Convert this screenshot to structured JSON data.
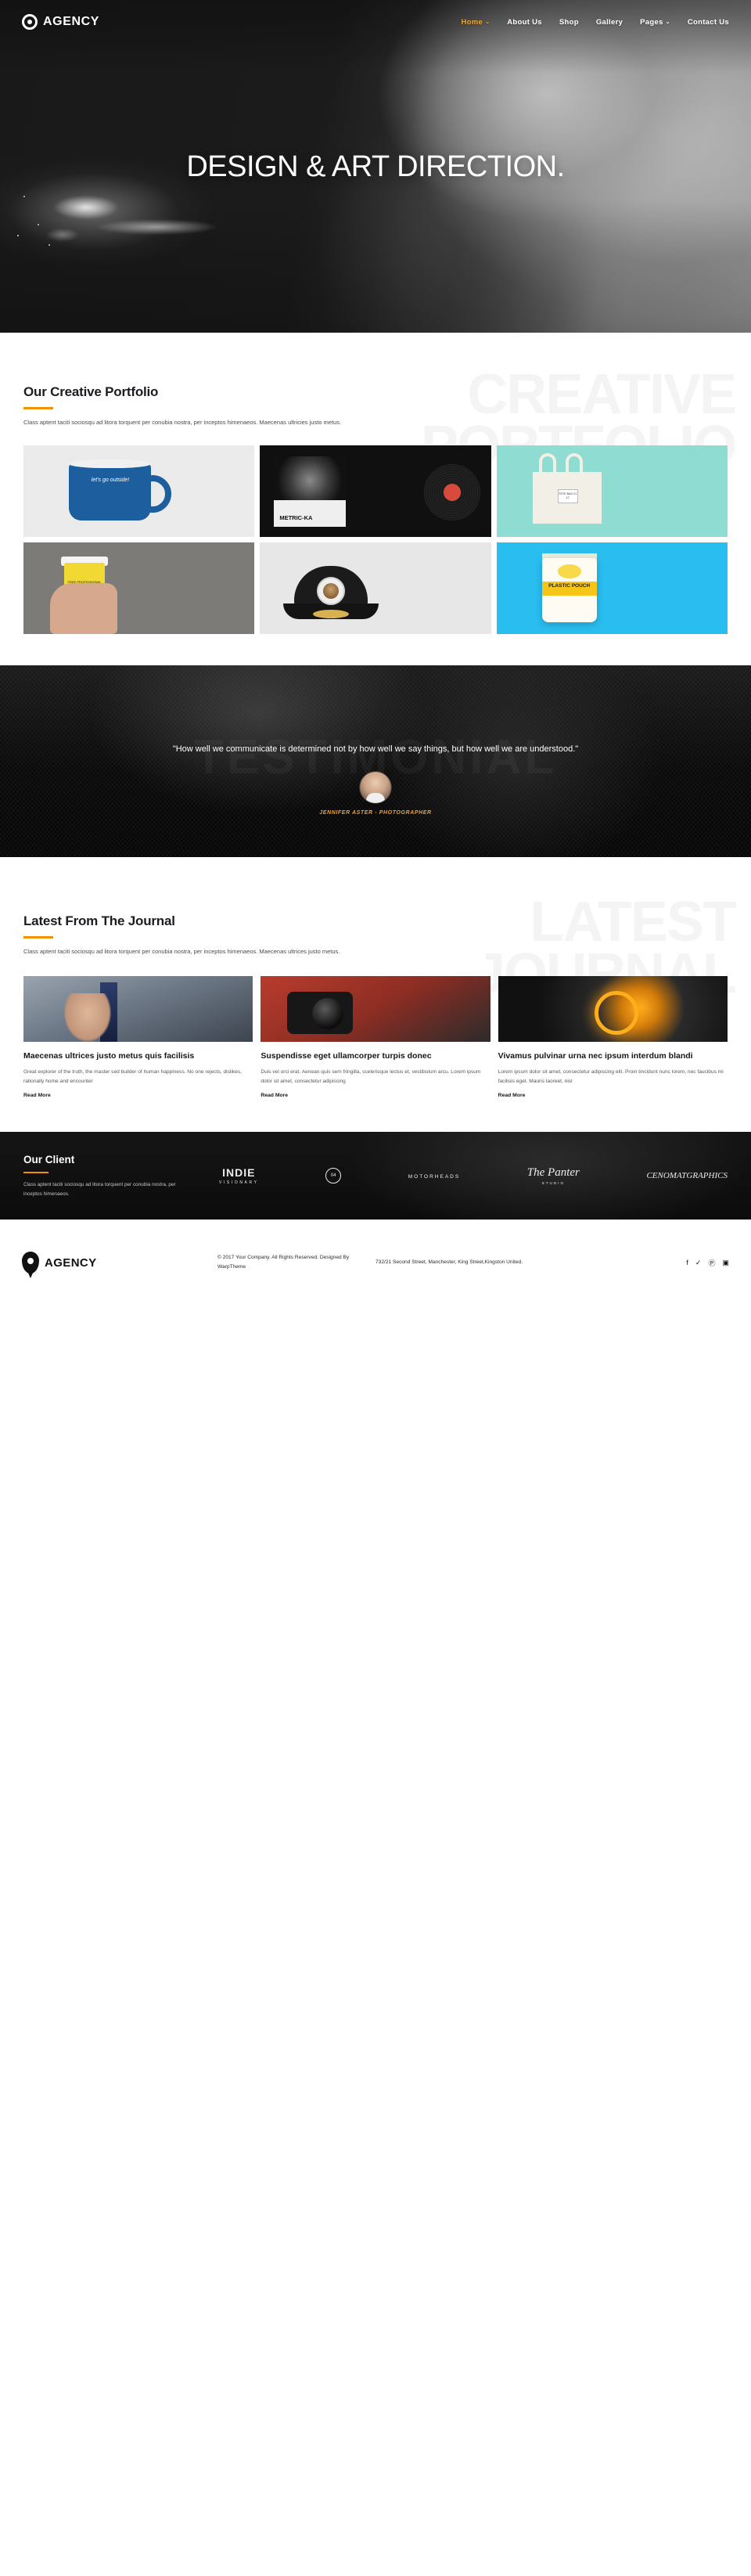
{
  "brand": {
    "name": "AGENCY",
    "icon": "location-pin-icon"
  },
  "nav": {
    "items": [
      {
        "label": "Home",
        "active": true,
        "caret": "⌄"
      },
      {
        "label": "About Us",
        "active": false,
        "caret": ""
      },
      {
        "label": "Shop",
        "active": false,
        "caret": ""
      },
      {
        "label": "Gallery",
        "active": false,
        "caret": ""
      },
      {
        "label": "Pages",
        "active": false,
        "caret": "⌄"
      },
      {
        "label": "Contact Us",
        "active": false,
        "caret": ""
      }
    ]
  },
  "hero": {
    "title": "DESIGN & ART DIRECTION."
  },
  "portfolio": {
    "watermark": "CREATIVE\nPORTFOLIO",
    "title": "Our Creative Portfolio",
    "desc": "Class aptent taciti sociosqu ad litora torquent per conubia nostra, per inceptos himenaeos. Maecenas ultricies justo metus.",
    "items": [
      {
        "name": "enamel-mug",
        "caption": "let's go outside!"
      },
      {
        "name": "vinyl-record",
        "caption": "METRIC-KA"
      },
      {
        "name": "tote-bag",
        "caption": "TOTE BAG 01 17"
      },
      {
        "name": "coffee-cup",
        "caption": "FREE PROFESSIONAL MOCKUP"
      },
      {
        "name": "snapback-cap",
        "caption": ""
      },
      {
        "name": "plastic-pouch",
        "caption": "PLASTIC POUCH"
      }
    ]
  },
  "testimonial": {
    "watermark": "TESTIMONIAL",
    "quote": "\"How well we communicate is determined not by how well we say things, but how well we are understood.\"",
    "author": "JENNIFER ASTER - PHOTOGRAPHER"
  },
  "journal": {
    "watermark": "LATEST\nJOURNAL",
    "title": "Latest From The Journal",
    "desc": "Class aptent taciti sociosqu ad litora torquent per conubia nostra, per inceptos himenaeos. Maecenas ultrices justo metus.",
    "posts": [
      {
        "title": "Maecenas ultrices justo metus quis facilisis",
        "excerpt": "Great explorer of the truth, the master sed builder of human happiness. No one rejects, dislikes, rationally home and encounter",
        "more": "Read More"
      },
      {
        "title": "Suspendisse eget ullamcorper turpis donec",
        "excerpt": "Duis vel orci erat. Aenean quis sem fringilla, scelerisque lectus et, vestibulum arcu. Lorem ipsum dolor sit amet, consectetur adipiscing",
        "more": "Read More"
      },
      {
        "title": "Vivamus pulvinar urna nec ipsum interdum blandi",
        "excerpt": "Lorem ipsum dolor sit amet, consectetur adipiscing elit. Proin tincidunt nunc lorem, nec faucibus mi facilisis eget. Mauris laoreet, nisl",
        "more": "Read More"
      }
    ]
  },
  "clients": {
    "title": "Our Client",
    "desc": "Class aptent taciti sociosqu ad litora torquent per conubia nostra, per inceptos himenaeos.",
    "logos": [
      {
        "primary": "INDIE",
        "secondary": "VISIONARY"
      },
      {
        "primary": "04",
        "secondary": ""
      },
      {
        "primary": "MOTORHEADS",
        "secondary": ""
      },
      {
        "primary": "The Panter",
        "secondary": "STUDIO"
      },
      {
        "primary": "CENOMATGRAPHICS",
        "secondary": ""
      }
    ]
  },
  "footer": {
    "brand": "AGENCY",
    "copyright": "© 2017 Your Company. All Rights Reserved. Designed By WarpTheme",
    "address": "732/21 Second Street, Manchester, King Street,Kingston United.",
    "social": [
      "f",
      "✓",
      "Ⓟ",
      "▣"
    ]
  },
  "colors": {
    "accent": "#f39200",
    "dark": "#111111",
    "muted": "#f4f4f4"
  }
}
